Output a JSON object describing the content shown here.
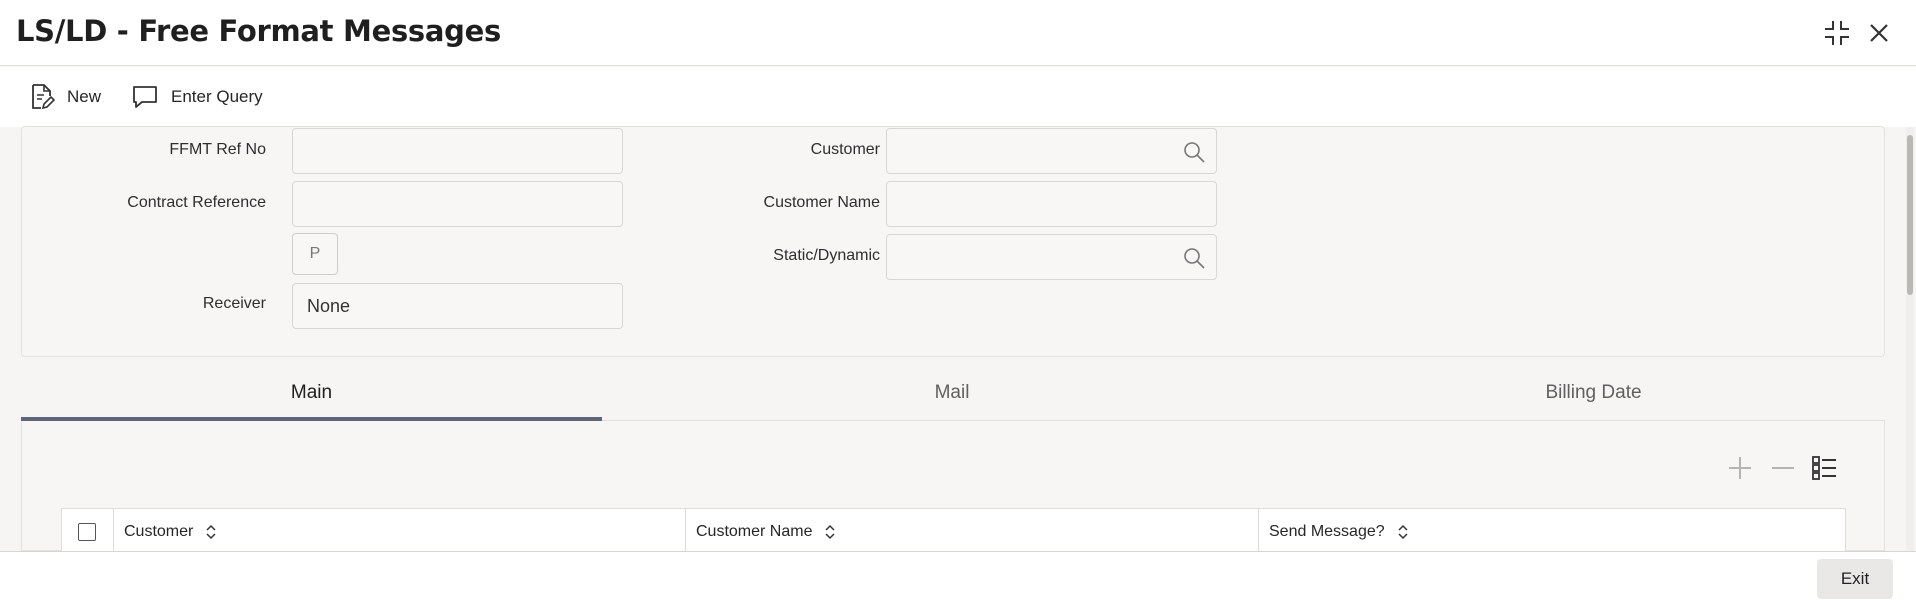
{
  "window": {
    "title": "LS/LD - Free Format Messages"
  },
  "toolbar": {
    "new_label": "New",
    "enter_query_label": "Enter Query"
  },
  "form": {
    "ffmt_ref_no": {
      "label": "FFMT Ref No",
      "value": ""
    },
    "contract_reference": {
      "label": "Contract Reference",
      "value": ""
    },
    "p_button": "P",
    "receiver": {
      "label": "Receiver",
      "value": "None"
    },
    "customer": {
      "label": "Customer",
      "value": ""
    },
    "customer_name": {
      "label": "Customer Name",
      "value": ""
    },
    "static_dynamic": {
      "label": "Static/Dynamic",
      "value": ""
    }
  },
  "tabs": [
    {
      "label": "Main",
      "active": true
    },
    {
      "label": "Mail",
      "active": false
    },
    {
      "label": "Billing Date",
      "active": false
    }
  ],
  "grid": {
    "columns": [
      "Customer",
      "Customer Name",
      "Send Message?"
    ],
    "tools": [
      "add-row-icon",
      "delete-row-icon",
      "single-view-icon"
    ]
  },
  "footer": {
    "exit_label": "Exit"
  },
  "colors": {
    "tab_underline": "#5f6478",
    "background": "#f6f5f3"
  }
}
